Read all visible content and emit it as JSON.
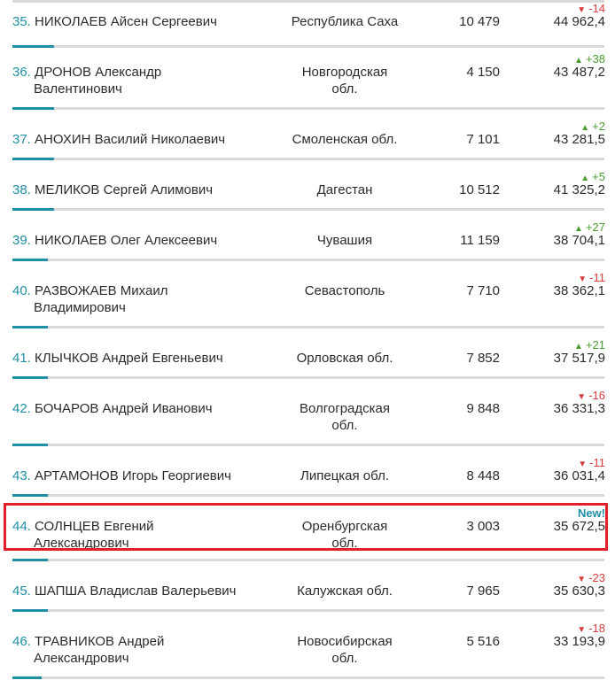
{
  "colors": {
    "accent": "#1f8fa6",
    "up": "#4a9c2d",
    "down": "#d93b3b",
    "divider": "#d9d9d9",
    "highlight": "#e0202a"
  },
  "rows": [
    {
      "rank": "35.",
      "name": "НИКОЛАЕВ Айсен Сергеевич",
      "region": "Республика Саха",
      "votes": "10 479",
      "score": "44 962,4",
      "change": "-14",
      "dir": "down",
      "fill": 0.07
    },
    {
      "rank": "36.",
      "name": "ДРОНОВ Александр Валентинович",
      "region": "Новгородская обл.",
      "votes": "4 150",
      "score": "43 487,2",
      "change": "+38",
      "dir": "up",
      "fill": 0.07
    },
    {
      "rank": "37.",
      "name": "АНОХИН Василий Николаевич",
      "region": "Смоленская обл.",
      "votes": "7 101",
      "score": "43 281,5",
      "change": "+2",
      "dir": "up",
      "fill": 0.07
    },
    {
      "rank": "38.",
      "name": "МЕЛИКОВ Сергей Алимович",
      "region": "Дагестан",
      "votes": "10 512",
      "score": "41 325,2",
      "change": "+5",
      "dir": "up",
      "fill": 0.07
    },
    {
      "rank": "39.",
      "name": "НИКОЛАЕВ Олег Алексеевич",
      "region": "Чувашия",
      "votes": "11 159",
      "score": "38 704,1",
      "change": "+27",
      "dir": "up",
      "fill": 0.06
    },
    {
      "rank": "40.",
      "name": "РАЗВОЖАЕВ Михаил Владимирович",
      "region": "Севастополь",
      "votes": "7 710",
      "score": "38 362,1",
      "change": "-11",
      "dir": "down",
      "fill": 0.06
    },
    {
      "rank": "41.",
      "name": "КЛЫЧКОВ Андрей Евгеньевич",
      "region": "Орловская обл.",
      "votes": "7 852",
      "score": "37 517,9",
      "change": "+21",
      "dir": "up",
      "fill": 0.06
    },
    {
      "rank": "42.",
      "name": "БОЧАРОВ Андрей Иванович",
      "region": "Волгоградская обл.",
      "votes": "9 848",
      "score": "36 331,3",
      "change": "-16",
      "dir": "down",
      "fill": 0.06
    },
    {
      "rank": "43.",
      "name": "АРТАМОНОВ Игорь Георгиевич",
      "region": "Липецкая обл.",
      "votes": "8 448",
      "score": "36 031,4",
      "change": "-11",
      "dir": "down",
      "fill": 0.06
    },
    {
      "rank": "44.",
      "name": "СОЛНЦЕВ Евгений Александрович",
      "region": "Оренбургская обл.",
      "votes": "3 003",
      "score": "35 672,5",
      "change": "New!",
      "dir": "new",
      "fill": 0.06,
      "highlighted": true
    },
    {
      "rank": "45.",
      "name": "ШАПША Владислав Валерьевич",
      "region": "Калужская обл.",
      "votes": "7 965",
      "score": "35 630,3",
      "change": "-23",
      "dir": "down",
      "fill": 0.06
    },
    {
      "rank": "46.",
      "name": "ТРАВНИКОВ Андрей Александрович",
      "region": "Новосибирская обл.",
      "votes": "5 516",
      "score": "33 193,9",
      "change": "-18",
      "dir": "down",
      "fill": 0.05
    }
  ]
}
